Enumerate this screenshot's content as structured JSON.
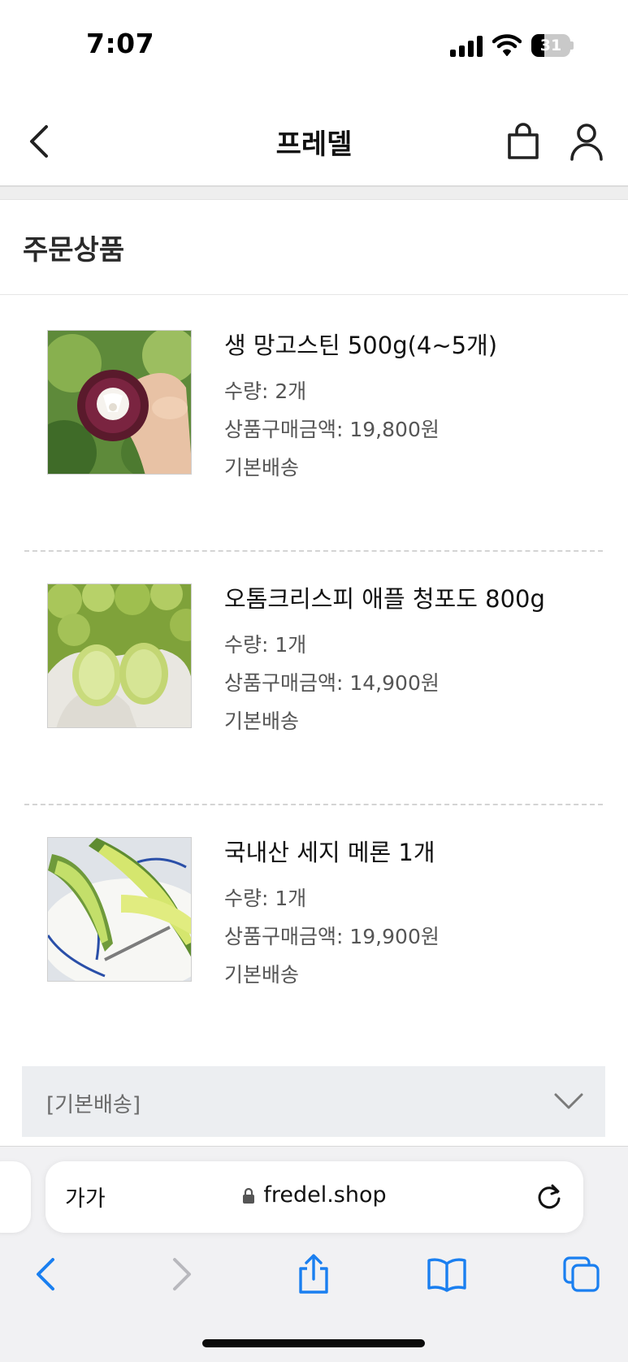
{
  "status_bar": {
    "time": "7:07",
    "battery_level": "31"
  },
  "header": {
    "title": "프레델"
  },
  "section": {
    "title": "주문상품"
  },
  "products": [
    {
      "name": "생 망고스틴 500g(4~5개)",
      "quantity": "수량: 2개",
      "price": "상품구매금액: 19,800원",
      "shipping": "기본배송"
    },
    {
      "name": "오톰크리스피 애플 청포도 800g",
      "quantity": "수량: 1개",
      "price": "상품구매금액: 14,900원",
      "shipping": "기본배송"
    },
    {
      "name": "국내산 세지 메론 1개",
      "quantity": "수량: 1개",
      "price": "상품구매금액: 19,900원",
      "shipping": "기본배송"
    }
  ],
  "delivery": {
    "label": "[기본배송]"
  },
  "browser": {
    "text_size_label": "가가",
    "url": "fredel.shop"
  },
  "colors": {
    "accent": "#1a7ff0",
    "disabled": "#b8b8bd"
  }
}
